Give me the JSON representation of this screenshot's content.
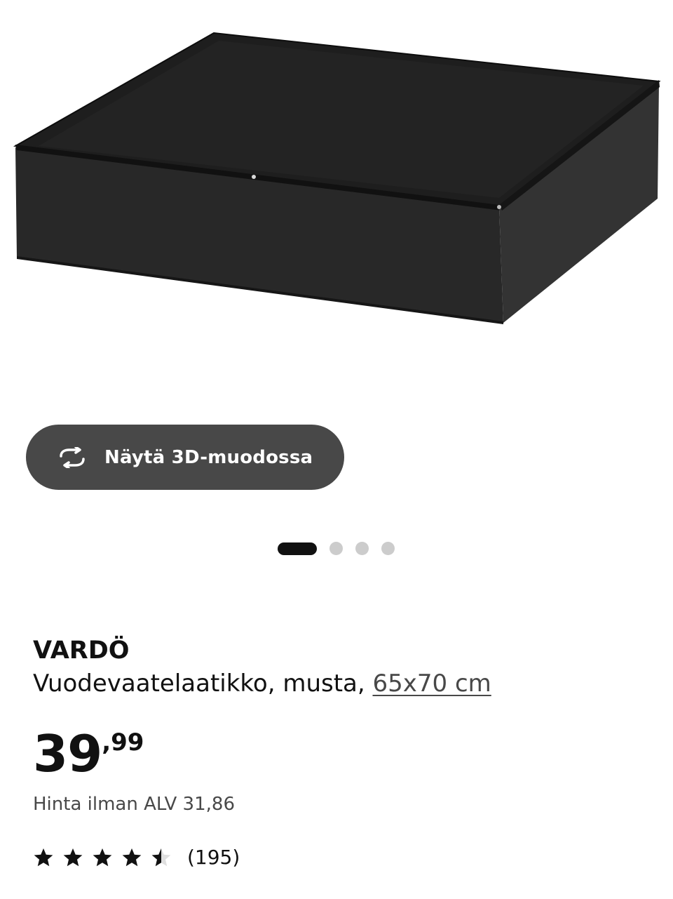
{
  "product": {
    "image_icon": "drawer-product-image",
    "view_3d_label": "Näytä 3D-muodossa",
    "name": "VARDÖ",
    "description": "Vuodevaatelaatikko, musta, ",
    "size": "65x70 cm",
    "price_integer": "39",
    "price_decimal": ",99",
    "price_ex_vat": "Hinta ilman ALV 31,86",
    "rating_value": 4.5,
    "rating_max": 5,
    "review_count": "(195)"
  },
  "carousel": {
    "total": 4,
    "active_index": 0
  },
  "colors": {
    "button_bg": "#484848",
    "text": "#111111",
    "muted": "#484848",
    "dot_inactive": "#cccccc"
  }
}
